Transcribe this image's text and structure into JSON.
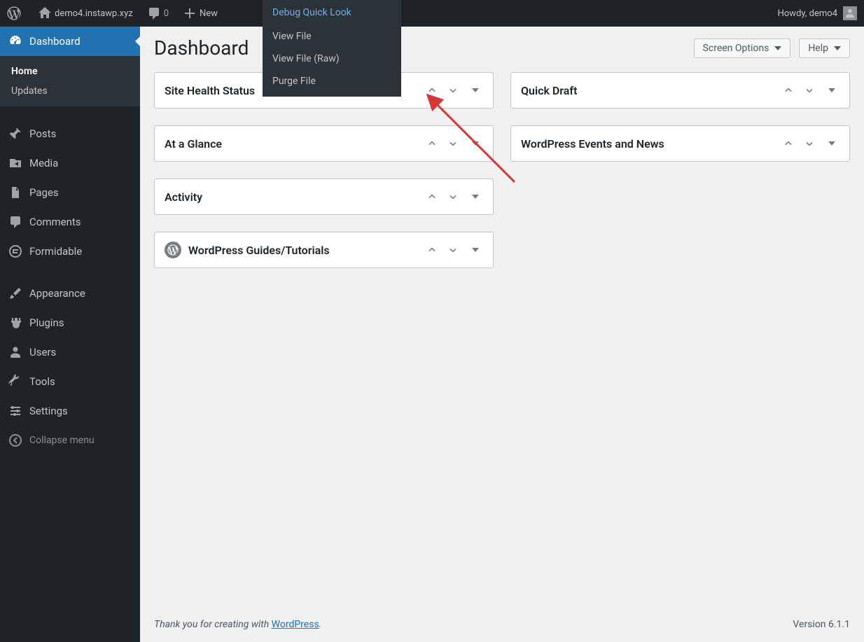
{
  "adminbar": {
    "site_name": "demo4.instawp.xyz",
    "comment_count": "0",
    "new_label": "New",
    "debug_label": "Debug Quick Look",
    "debug_items": [
      "View File",
      "View File (Raw)",
      "Purge File"
    ],
    "howdy": "Howdy, demo4"
  },
  "sidebar": {
    "items": [
      {
        "id": "dashboard",
        "label": "Dashboard",
        "icon": "dashboard"
      },
      {
        "id": "posts",
        "label": "Posts",
        "icon": "pin"
      },
      {
        "id": "media",
        "label": "Media",
        "icon": "media"
      },
      {
        "id": "pages",
        "label": "Pages",
        "icon": "pages"
      },
      {
        "id": "comments",
        "label": "Comments",
        "icon": "comment"
      },
      {
        "id": "formidable",
        "label": "Formidable",
        "icon": "formidable"
      },
      {
        "id": "appearance",
        "label": "Appearance",
        "icon": "brush"
      },
      {
        "id": "plugins",
        "label": "Plugins",
        "icon": "plug"
      },
      {
        "id": "users",
        "label": "Users",
        "icon": "user"
      },
      {
        "id": "tools",
        "label": "Tools",
        "icon": "wrench"
      },
      {
        "id": "settings",
        "label": "Settings",
        "icon": "sliders"
      }
    ],
    "submenu": [
      {
        "id": "home",
        "label": "Home",
        "current": true
      },
      {
        "id": "updates",
        "label": "Updates",
        "current": false
      }
    ],
    "collapse_label": "Collapse menu"
  },
  "page": {
    "title": "Dashboard",
    "screen_options_label": "Screen Options",
    "help_label": "Help"
  },
  "metaboxes": {
    "left": [
      {
        "id": "site-health",
        "title": "Site Health Status"
      },
      {
        "id": "at-a-glance",
        "title": "At a Glance"
      },
      {
        "id": "activity",
        "title": "Activity"
      },
      {
        "id": "wp-tutorials",
        "title": "WordPress Guides/Tutorials",
        "icon": "wp"
      }
    ],
    "right": [
      {
        "id": "quick-draft",
        "title": "Quick Draft"
      },
      {
        "id": "wp-events-news",
        "title": "WordPress Events and News"
      }
    ]
  },
  "footer": {
    "thank_you_prefix": "Thank you for creating with ",
    "thank_you_link": "WordPress",
    "thank_you_suffix": ".",
    "version": "Version 6.1.1"
  }
}
